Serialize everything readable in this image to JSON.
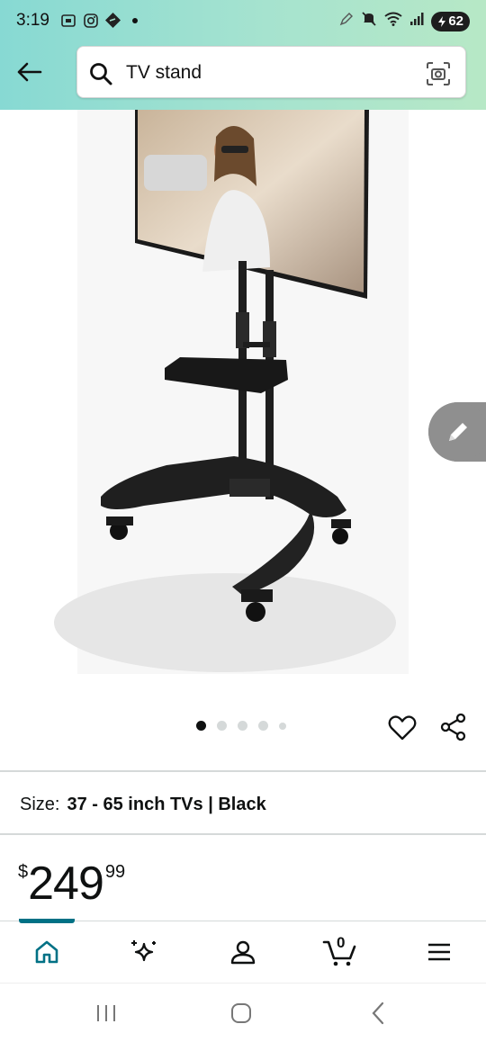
{
  "status_bar": {
    "time": "3:19",
    "battery": "62",
    "left_icons": [
      "screenshot-icon",
      "instagram-icon",
      "offer-tag-icon",
      "notification-dot"
    ],
    "right_icons": [
      "stylus-icon",
      "mute-icon",
      "wifi-icon",
      "signal-icon",
      "battery-icon"
    ]
  },
  "header": {
    "back_icon": "back-arrow-icon",
    "search": {
      "query": "TV stand",
      "icons": [
        "search-icon",
        "camera-search-icon"
      ]
    }
  },
  "product": {
    "image_description_icon": "tv-stand-product-image",
    "carousel": {
      "count": 5,
      "active_index": 0
    },
    "actions": [
      "heart-icon",
      "share-icon"
    ],
    "size_label": "Size:",
    "size_value": "37 - 65 inch TVs | Black",
    "price": {
      "currency": "$",
      "whole": "249",
      "fraction": "99"
    }
  },
  "bottom_nav": {
    "items": [
      {
        "name": "home",
        "icon": "home-icon",
        "active": true
      },
      {
        "name": "rufus",
        "icon": "sparkle-icon",
        "active": false
      },
      {
        "name": "account",
        "icon": "person-icon",
        "active": false
      },
      {
        "name": "cart",
        "icon": "cart-icon",
        "active": false,
        "count": "0"
      },
      {
        "name": "menu",
        "icon": "menu-icon",
        "active": false
      }
    ]
  },
  "colors": {
    "header_gradient_start": "#87d9d3",
    "header_gradient_end": "#b7e8c6",
    "accent": "#007185"
  }
}
